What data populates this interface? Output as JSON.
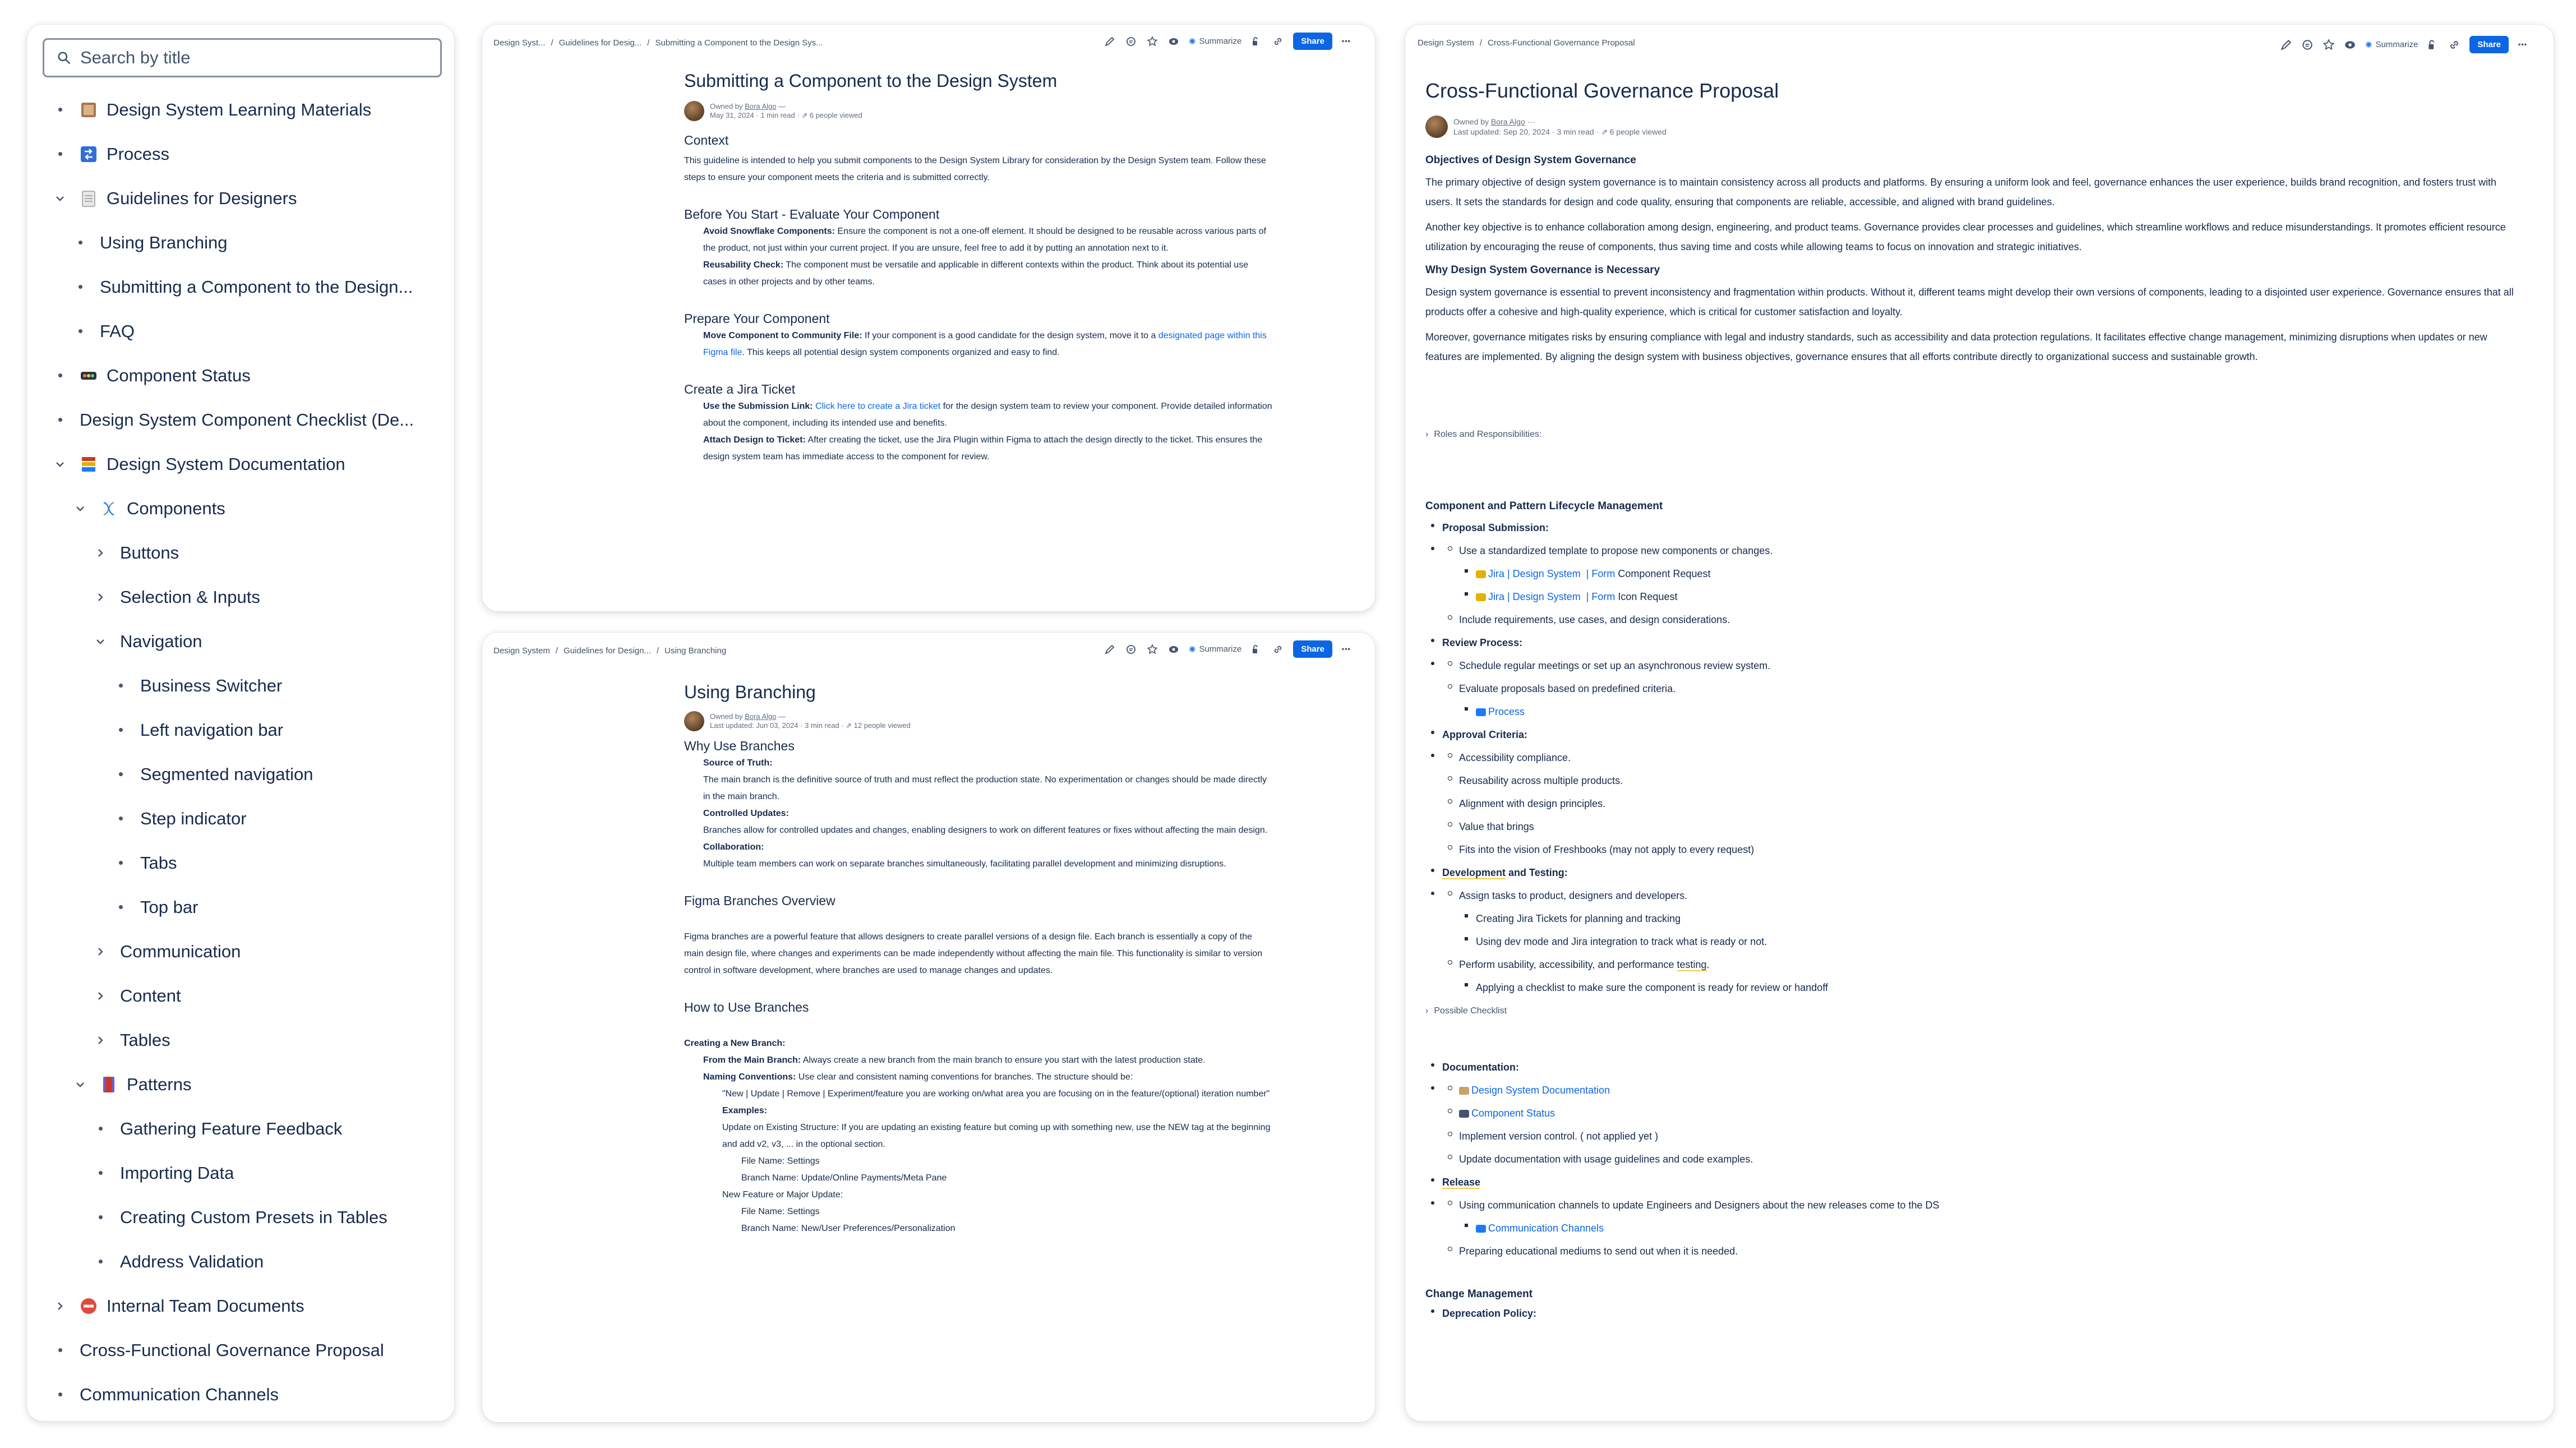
{
  "sidebar": {
    "search_placeholder": "Search by title",
    "items": [
      {
        "label": "Design System Learning Materials",
        "depth": 0,
        "ctl": "dot",
        "icon": "book-icon"
      },
      {
        "label": "Process",
        "depth": 0,
        "ctl": "dot",
        "icon": "process-icon"
      },
      {
        "label": "Guidelines for Designers",
        "depth": 0,
        "ctl": "down",
        "icon": "notepad-icon"
      },
      {
        "label": "Using Branching",
        "depth": 1,
        "ctl": "dot",
        "icon": ""
      },
      {
        "label": "Submitting a Component to the Design...",
        "depth": 1,
        "ctl": "dot",
        "icon": ""
      },
      {
        "label": "FAQ",
        "depth": 1,
        "ctl": "dot",
        "icon": ""
      },
      {
        "label": "Component Status",
        "depth": 0,
        "ctl": "dot",
        "icon": "status-icon"
      },
      {
        "label": "Design System Component Checklist (De...",
        "depth": 0,
        "ctl": "dot",
        "icon": ""
      },
      {
        "label": "Design System Documentation",
        "depth": 0,
        "ctl": "down",
        "icon": "books-icon"
      },
      {
        "label": "Components",
        "depth": 1,
        "ctl": "down",
        "icon": "dna-icon"
      },
      {
        "label": "Buttons",
        "depth": 2,
        "ctl": "right",
        "icon": ""
      },
      {
        "label": "Selection & Inputs",
        "depth": 2,
        "ctl": "right",
        "icon": ""
      },
      {
        "label": "Navigation",
        "depth": 2,
        "ctl": "down",
        "icon": ""
      },
      {
        "label": "Business Switcher",
        "depth": 3,
        "ctl": "dot",
        "icon": ""
      },
      {
        "label": "Left navigation bar",
        "depth": 3,
        "ctl": "dot",
        "icon": ""
      },
      {
        "label": "Segmented navigation",
        "depth": 3,
        "ctl": "dot",
        "icon": ""
      },
      {
        "label": "Step indicator",
        "depth": 3,
        "ctl": "dot",
        "icon": ""
      },
      {
        "label": "Tabs",
        "depth": 3,
        "ctl": "dot",
        "icon": ""
      },
      {
        "label": "Top bar",
        "depth": 3,
        "ctl": "dot",
        "icon": ""
      },
      {
        "label": "Communication",
        "depth": 2,
        "ctl": "right",
        "icon": ""
      },
      {
        "label": "Content",
        "depth": 2,
        "ctl": "right",
        "icon": ""
      },
      {
        "label": "Tables",
        "depth": 2,
        "ctl": "right",
        "icon": ""
      },
      {
        "label": "Patterns",
        "depth": 1,
        "ctl": "down",
        "icon": "bookmark-icon"
      },
      {
        "label": "Gathering Feature Feedback",
        "depth": 2,
        "ctl": "dot",
        "icon": ""
      },
      {
        "label": "Importing Data",
        "depth": 2,
        "ctl": "dot",
        "icon": ""
      },
      {
        "label": "Creating Custom Presets in Tables",
        "depth": 2,
        "ctl": "dot",
        "icon": ""
      },
      {
        "label": "Address Validation",
        "depth": 2,
        "ctl": "dot",
        "icon": ""
      },
      {
        "label": "Internal Team Documents",
        "depth": 0,
        "ctl": "right",
        "icon": "no-entry-icon"
      },
      {
        "label": "Cross-Functional Governance Proposal",
        "depth": 0,
        "ctl": "dot",
        "icon": ""
      },
      {
        "label": "Communication Channels",
        "depth": 0,
        "ctl": "dot",
        "icon": ""
      }
    ]
  },
  "toolbar": {
    "summarize": "Summarize",
    "share": "Share",
    "more": "···"
  },
  "pageA": {
    "crumbs": [
      "Design Syst...",
      "Guidelines for Desig...",
      "Submitting a Component to the Design Sys..."
    ],
    "title": "Submitting a Component to the Design System",
    "owned_by": "Owned by",
    "owner": "Bora Algo",
    "dash": "—",
    "date": "May 31, 2024",
    "read": "1 min read",
    "viewed": "6 people viewed",
    "context_h": "Context",
    "context_p": "This guideline is intended to help you submit components to the Design System Library for consideration by the Design System team. Follow these steps to ensure your component meets the criteria and is submitted correctly.",
    "before_h": "Before You Start - Evaluate Your Component",
    "avoid_b": "Avoid Snowflake Components:",
    "avoid_t": " Ensure the component is not a one-off element. It should be designed to be reusable across various parts of the product, not just within your current project. If you are unsure, feel free to add it by putting an annotation next to it.",
    "reuse_b": "Reusability Check:",
    "reuse_t": " The component must be versatile and applicable in different contexts within the product. Think about its potential use cases in other projects and by other teams.",
    "prepare_h": "Prepare Your Component",
    "move_b": "Move Component to Community File:",
    "move_t1": " If your component is a good candidate for the design system, move it to a ",
    "move_link": "designated page within this Figma file",
    "move_t2": ". This keeps all potential design system components organized and easy to find.",
    "jira_h": "Create a Jira Ticket",
    "sub_b": "Use the Submission Link:",
    "sub_link": "Click here to create a Jira ticket",
    "sub_t": " for the design system team to review your component. Provide detailed information about the component, including its intended use and benefits.",
    "attach_b": "Attach Design to Ticket:",
    "attach_t": " After creating the ticket, use the Jira Plugin within Figma to attach the design directly to the ticket. This ensures the design system team has immediate access to the component for review."
  },
  "pageB": {
    "crumbs": [
      "Design System",
      "Guidelines for Design...",
      "Using Branching"
    ],
    "title": "Using Branching",
    "owned_by": "Owned by",
    "owner": "Bora Algo",
    "dash": "—",
    "date": "Last updated: Jun 03, 2024",
    "read": "3 min read",
    "viewed": "12 people viewed",
    "why_h": "Why Use Branches",
    "sot_b": "Source of Truth:",
    "sot_t": "The main branch is the definitive source of truth and must reflect the production state. No experimentation or changes should be made directly in the main branch.",
    "cu_b": "Controlled Updates:",
    "cu_t": "Branches allow for controlled updates and changes, enabling designers to work on different features or fixes without affecting the main design.",
    "col_b": "Collaboration:",
    "col_t": "Multiple team members can work on separate branches simultaneously, facilitating parallel development and minimizing disruptions.",
    "fbo_h": "Figma Branches Overview",
    "fbo_p": "Figma branches are a powerful feature that allows designers to create parallel versions of a design file. Each branch is essentially a copy of the main design file, where changes and experiments can be made independently without affecting the main file. This functionality is similar to version control in software development, where branches are used to manage changes and updates.",
    "how_h": "How to Use Branches",
    "cnb_b": "Creating a New Branch:",
    "fmb_b": "From the Main Branch:",
    "fmb_t": " Always create a new branch from the main branch to ensure you start with the latest production state.",
    "nc_b": "Naming Conventions:",
    "nc_t": " Use clear and consistent naming conventions for branches. The structure should be:",
    "pattern": "\"New | Update | Remove | Experiment/feature you are working on/what area you are focusing on in the feature/(optional) iteration number\"",
    "ex_b": "Examples:",
    "ex_t": "Update on Existing Structure: If you are updating an existing feature but coming up with something new, use the NEW tag at the beginning and add v2, v3, ... in the optional section.",
    "fn1": "File Name: Settings",
    "bn1": "Branch Name: Update/Online Payments/Meta Pane",
    "nf": "New Feature or Major Update:",
    "fn2": "File Name: Settings",
    "bn2": "Branch Name: New/User Preferences/Personalization"
  },
  "pageC": {
    "crumbs": [
      "Design System",
      "Cross-Functional Governance Proposal"
    ],
    "title": "Cross-Functional Governance Proposal",
    "owned_by": "Owned by",
    "owner": "Bora Algo",
    "dash": "···",
    "date": "Last updated: Sep 20, 2024",
    "read": "3 min read",
    "viewed": "6 people viewed",
    "obj_h": "Objectives of Design System Governance",
    "obj_p1": "The primary objective of design system governance is to maintain consistency across all products and platforms. By ensuring a uniform look and feel, governance enhances the user experience, builds brand recognition, and fosters trust with users. It sets the standards for design and code quality, ensuring that components are reliable, accessible, and aligned with brand guidelines.",
    "obj_p2": "Another key objective is to enhance collaboration among design, engineering, and product teams. Governance provides clear processes and guidelines, which streamline workflows and reduce misunderstandings. It promotes efficient resource utilization by encouraging the reuse of components, thus saving time and costs while allowing teams to focus on innovation and strategic initiatives.",
    "why_h": "Why Design System Governance is Necessary",
    "why_p1": "Design system governance is essential to prevent inconsistency and fragmentation within products. Without it, different teams might develop their own versions of components, leading to a disjointed user experience. Governance ensures that all products offer a cohesive and high-quality experience, which is critical for customer satisfaction and loyalty.",
    "why_p2": "Moreover, governance mitigates risks by ensuring compliance with legal and industry standards, such as accessibility and data protection regulations. It facilitates effective change management, minimizing disruptions when updates or new features are implemented. By aligning the design system with business objectives, governance ensures that all efforts contribute directly to organizational success and sustainable growth.",
    "roles": "Roles and Responsibilities:",
    "lcm_h": "Component and Pattern Lifecycle Management",
    "ps_b": "Proposal Submission:",
    "ps_1": "Use a standardized template to propose new components or changes.",
    "ps_l1a": "Jira | Design System",
    "ps_l1b": "| Form",
    "ps_l1c": " Component Request",
    "ps_l2a": "Jira | Design System",
    "ps_l2b": "| Form",
    "ps_l2c": " Icon Request",
    "ps_2": "Include requirements, use cases, and design considerations.",
    "rp_b": "Review Process:",
    "rp_1": "Schedule regular meetings or set up an asynchronous review system.",
    "rp_2": "Evaluate proposals based on predefined criteria.",
    "rp_link": "Process",
    "ac_b": "Approval Criteria:",
    "ac_1": "Accessibility compliance.",
    "ac_2": "Reusability across multiple products.",
    "ac_3": "Alignment with design principles.",
    "ac_4": "Value that brings",
    "ac_5": "Fits into the vision of Freshbooks (may not apply to every request)",
    "dt_b1": "Development",
    "dt_b2": " and Testing:",
    "dt_1": "Assign tasks to product, designers and developers.",
    "dt_1a": "Creating Jira Tickets for planning and tracking",
    "dt_1b": "Using dev mode and Jira integration to track what is ready or not.",
    "dt_2a": "Perform usability, accessibility, and performance ",
    "dt_2b": "testing",
    "dt_2c": ".",
    "dt_2x": "Applying a checklist to make sure the component is ready for review or handoff",
    "checklist": "Possible Checklist",
    "doc_b": "Documentation:",
    "doc_l1": "Design System Documentation",
    "doc_l2": "Component Status",
    "doc_1": "Implement version control. ( not applied yet )",
    "doc_2": "Update documentation with usage guidelines and code examples.",
    "rel_b": "Release",
    "rel_1": "Using communication channels to update Engineers and Designers about the new releases come to the DS",
    "rel_link": "Communication Channels",
    "rel_2": "Preparing educational mediums to send out when it is needed.",
    "cm_h": "Change Management",
    "dp_b": "Deprecation Policy:"
  }
}
